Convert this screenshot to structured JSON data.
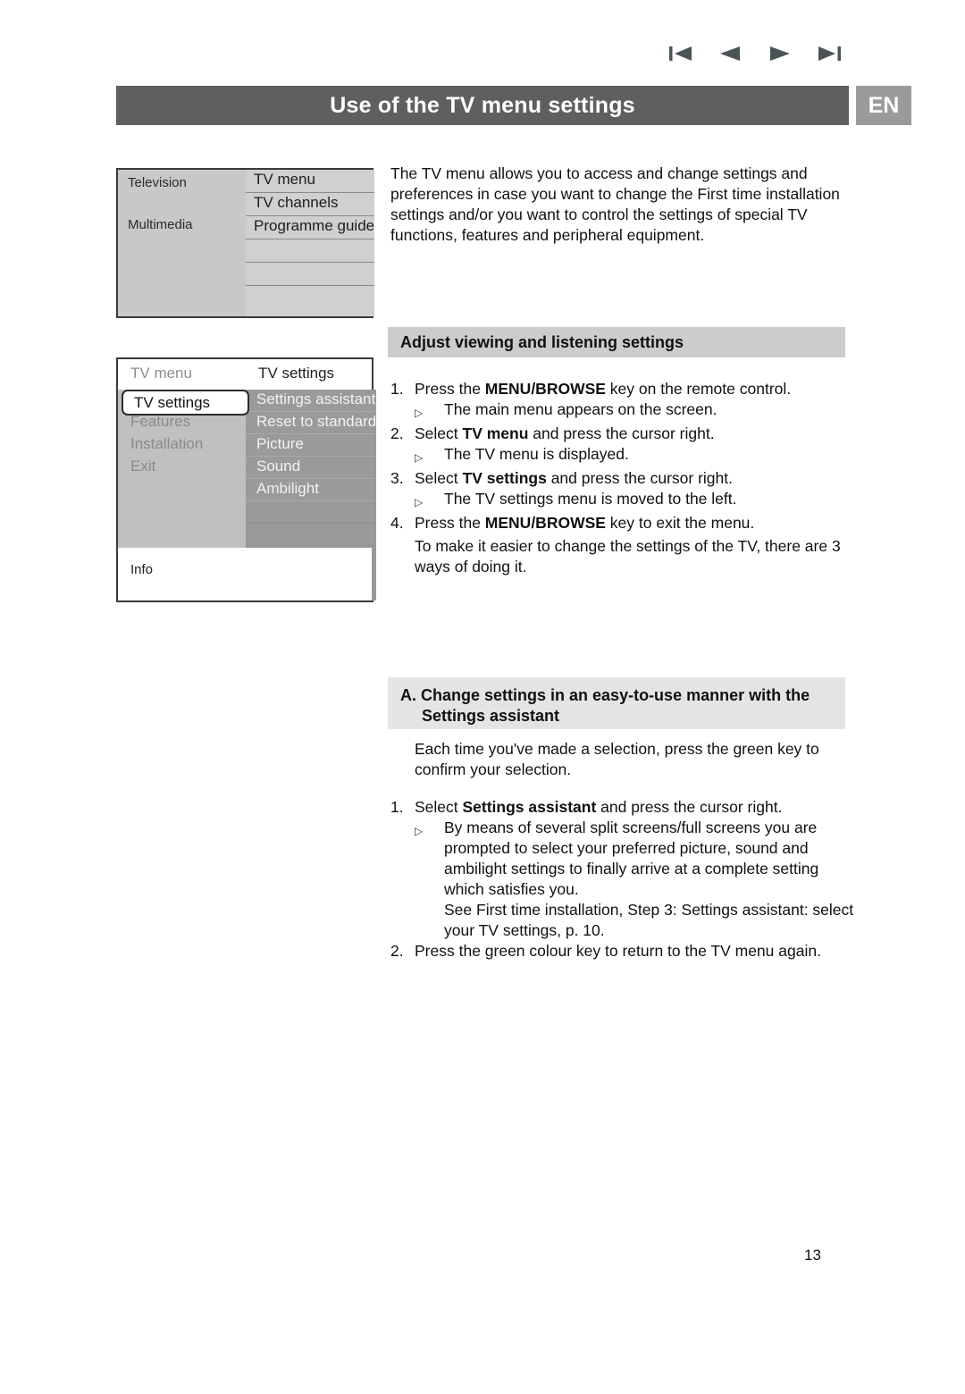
{
  "nav": {
    "icons": [
      {
        "name": "first-page-icon",
        "label": "First page"
      },
      {
        "name": "previous-page-icon",
        "label": "Previous page"
      },
      {
        "name": "next-page-icon",
        "label": "Next page"
      },
      {
        "name": "last-page-icon",
        "label": "Last page"
      }
    ]
  },
  "header": {
    "title": "Use of the TV menu settings",
    "language_badge": "EN",
    "band_color": "#5f5f5f",
    "badge_color": "#9a9a9a"
  },
  "tv_menu_diagram_1": {
    "left_items": [
      "Television",
      "Multimedia"
    ],
    "right_items": [
      "TV menu",
      "TV channels",
      "Programme guide",
      "",
      "",
      ""
    ]
  },
  "tv_menu_diagram_2": {
    "left_header": "TV menu",
    "right_header": "TV settings",
    "selected_item": "TV settings",
    "left_items": [
      "TV settings",
      "Features",
      "Installation",
      "Exit",
      "",
      "",
      ""
    ],
    "right_items": [
      "Settings assistant",
      "Reset to standard",
      "Picture",
      "Sound",
      "Ambilight",
      "",
      ""
    ],
    "footer": "Info"
  },
  "intro": {
    "text": "The TV menu allows you to access and change settings and preferences in case you want to change the First time installation settings and/or you want to control the settings of special TV functions, features and peripheral equipment."
  },
  "section_adjust": {
    "heading": "Adjust viewing and listening settings",
    "band_color": "#cccccc",
    "steps": [
      {
        "num": "1.",
        "text_pre": "Press the ",
        "bold": "MENU/BROWSE",
        "text_post": " key on the remote control."
      },
      {
        "num": "2.",
        "text_pre": "Select ",
        "bold": "TV menu",
        "text_post": " and press the cursor right."
      },
      {
        "num": "3.",
        "text_pre": "Select ",
        "bold": "TV settings",
        "text_post": " and press the cursor right."
      },
      {
        "num": "4.",
        "text_pre": "Press the ",
        "bold": "MENU/BROWSE",
        "text_post": " key to exit the menu."
      }
    ],
    "sub_1": "The main menu appears on the screen.",
    "sub_2": "The TV menu is displayed.",
    "sub_3": "The TV settings menu is moved to the left.",
    "paragraph": "To make it easier to change the settings of the TV, there are 3 ways of doing it."
  },
  "section_change": {
    "label": "A.",
    "heading_line1": "Change settings in an easy-to-use manner with the",
    "heading_line2": "Settings assistant",
    "band_color": "#e4e4e4",
    "intro_paragraph": "Each time you've made a selection, press the green key to confirm your selection.",
    "step_1": {
      "num": "1.",
      "text_pre": "Select ",
      "bold": "Settings assistant",
      "text_post": " and press the cursor right."
    },
    "sub_1a": "By means of several split screens/full screens you are prompted to select your preferred picture, sound and ambilight settings to finally arrive at a complete setting which satisfies you.",
    "sub_1b": "See First time installation, Step 3: Settings assistant: select your TV settings, p. 10.",
    "step_2": {
      "num": "2.",
      "text": "Press the green colour key to return to the TV menu again."
    }
  },
  "footer": {
    "page_number": "13"
  }
}
